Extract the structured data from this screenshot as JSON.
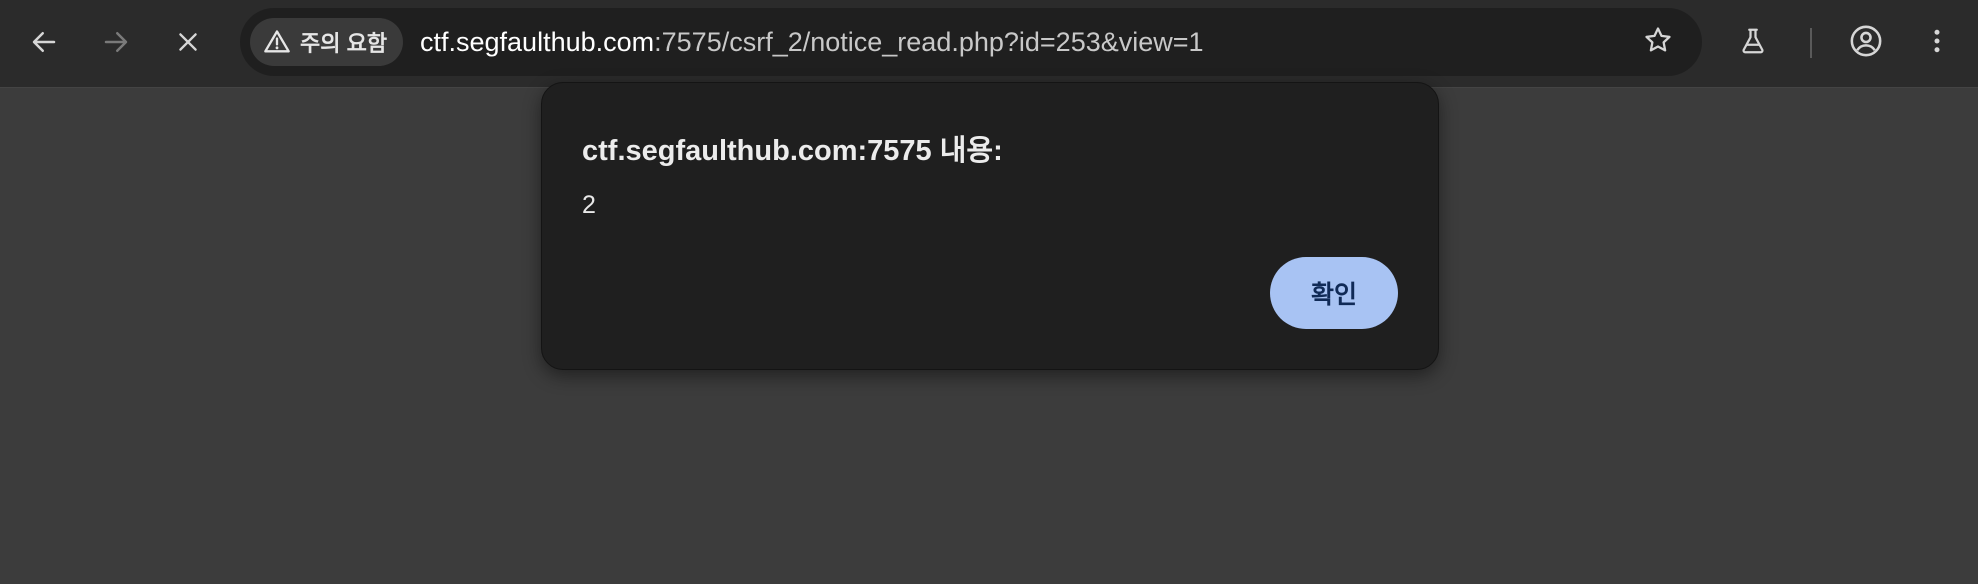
{
  "toolbar": {
    "back_icon": "arrow-left-icon",
    "forward_icon": "arrow-right-icon",
    "stop_icon": "close-icon",
    "security_chip": {
      "icon": "warning-triangle-icon",
      "label": "주의 요함"
    },
    "url": {
      "host": "ctf.segfaulthub.com",
      "path": ":7575/csrf_2/notice_read.php?id=253&view=1"
    },
    "bookmark_icon": "star-icon",
    "labs_icon": "flask-icon",
    "profile_icon": "account-circle-icon",
    "menu_icon": "kebab-menu-icon"
  },
  "dialog": {
    "title": "ctf.segfaulthub.com:7575 내용:",
    "message": "2",
    "ok_label": "확인"
  },
  "colors": {
    "toolbar_bg": "#2b2b2b",
    "page_bg": "#3c3c3c",
    "dialog_bg": "#1f1f1f",
    "button_bg": "#a8c3f3",
    "button_text": "#102a56"
  }
}
